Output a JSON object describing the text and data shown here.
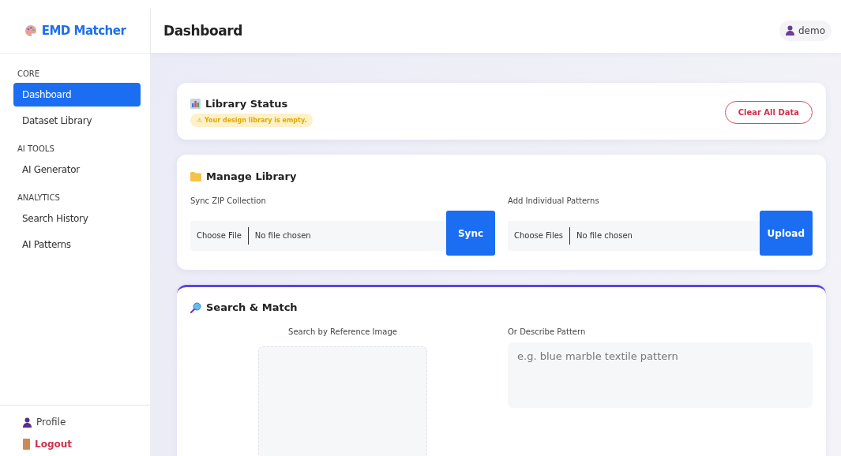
{
  "brand": {
    "name": "EMD Matcher"
  },
  "sidebar": {
    "sections": [
      {
        "heading": "CORE",
        "items": [
          {
            "label": "Dashboard",
            "selected": true
          },
          {
            "label": "Dataset Library",
            "selected": false
          }
        ]
      },
      {
        "heading": "AI TOOLS",
        "items": [
          {
            "label": "AI Generator",
            "selected": false
          }
        ]
      },
      {
        "heading": "ANALYTICS",
        "items": [
          {
            "label": "Search History",
            "selected": false
          },
          {
            "label": "AI Patterns",
            "selected": false
          }
        ]
      }
    ],
    "footer": [
      {
        "label": "Profile",
        "kind": "profile"
      },
      {
        "label": "Logout",
        "kind": "logout"
      }
    ]
  },
  "header": {
    "title": "Dashboard",
    "user": "demo"
  },
  "library_status": {
    "title": "Library Status",
    "alert": "⚠ Your design library is empty.",
    "button": "Clear All Data"
  },
  "manage_library": {
    "title": "Manage Library",
    "uploads": [
      {
        "label": "Sync ZIP Collection",
        "choose": "Choose File",
        "status": "No file chosen",
        "button": "Sync"
      },
      {
        "label": "Add Individual Patterns",
        "choose": "Choose Files",
        "status": "No file chosen",
        "button": "Upload"
      }
    ]
  },
  "search": {
    "title": "Search & Match",
    "image_label": "Search by Reference Image",
    "text_label": "Or Describe Pattern",
    "placeholder": "e.g. blue marble textile pattern"
  }
}
